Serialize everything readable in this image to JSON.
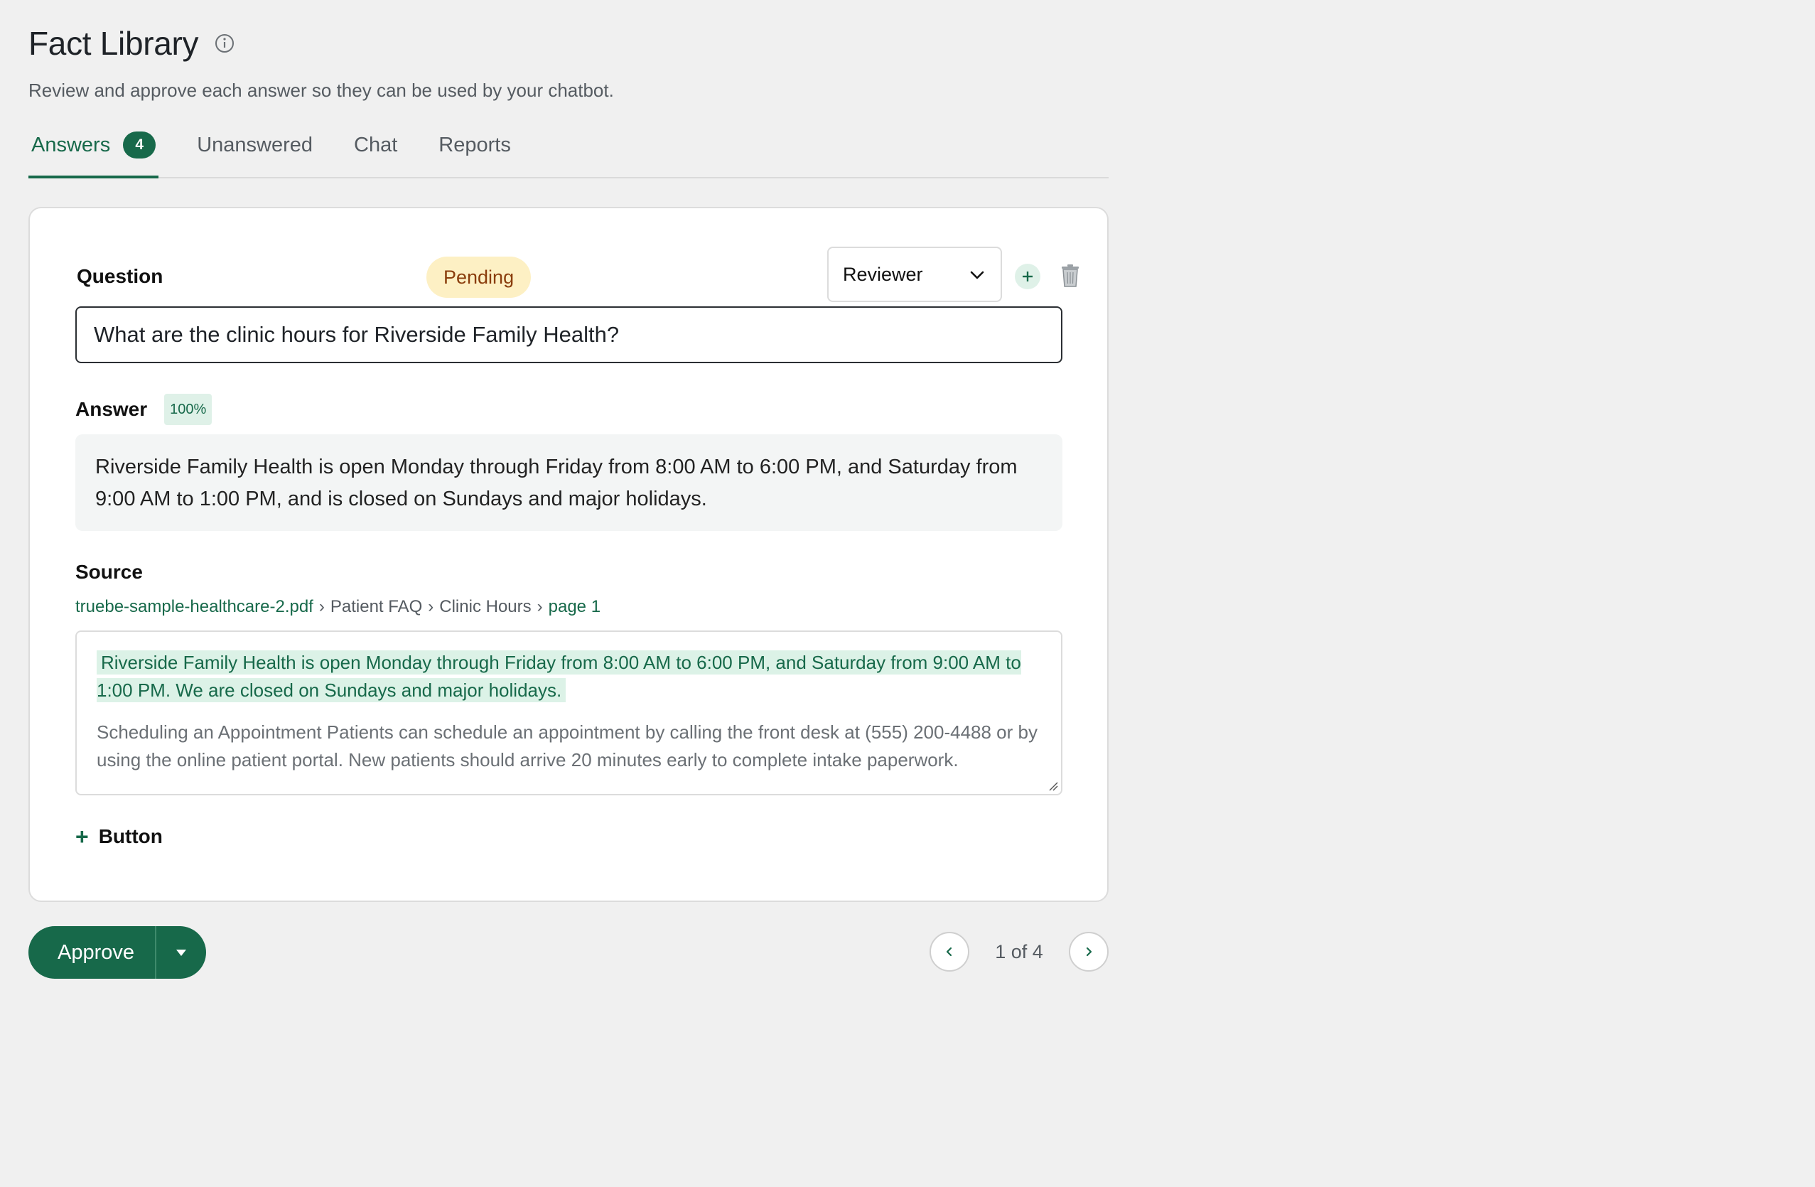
{
  "header": {
    "title": "Fact Library",
    "subtitle": "Review and approve each answer so they can be used by your chatbot."
  },
  "tabs": [
    {
      "label": "Answers",
      "count": "4",
      "active": true
    },
    {
      "label": "Unanswered"
    },
    {
      "label": "Chat"
    },
    {
      "label": "Reports"
    }
  ],
  "card": {
    "question_label": "Question",
    "status": "Pending",
    "reviewer_select": {
      "value": "Reviewer"
    },
    "question_value": "What are the clinic hours for Riverside Family Health?",
    "answer_label": "Answer",
    "confidence": "100%",
    "answer_text": "Riverside Family Health is open Monday through Friday from 8:00 AM to 6:00 PM, and Saturday from 9:00 AM to 1:00 PM, and is closed on Sundays and major holidays.",
    "source_label": "Source",
    "breadcrumb": {
      "file": "truebe-sample-healthcare-2.pdf",
      "section1": "Patient FAQ",
      "section2": "Clinic Hours",
      "page": "page 1"
    },
    "source_highlight": "Riverside Family Health is open Monday through Friday from 8:00 AM to 6:00 PM, and Saturday from 9:00 AM to 1:00 PM. We are closed on Sundays and major holidays.",
    "source_rest": "Scheduling an Appointment Patients can schedule an appointment by calling the front desk at (555) 200-4488 or by using the online patient portal. New patients should arrive 20 minutes early to complete intake paperwork.",
    "add_button_label": "Button"
  },
  "footer": {
    "approve_label": "Approve",
    "pager_text": "1 of 4"
  },
  "colors": {
    "brand": "#17694a",
    "pending_bg": "#fdf0c4",
    "pending_text": "#8a3d0c",
    "highlight_bg": "#dcf2e7"
  }
}
